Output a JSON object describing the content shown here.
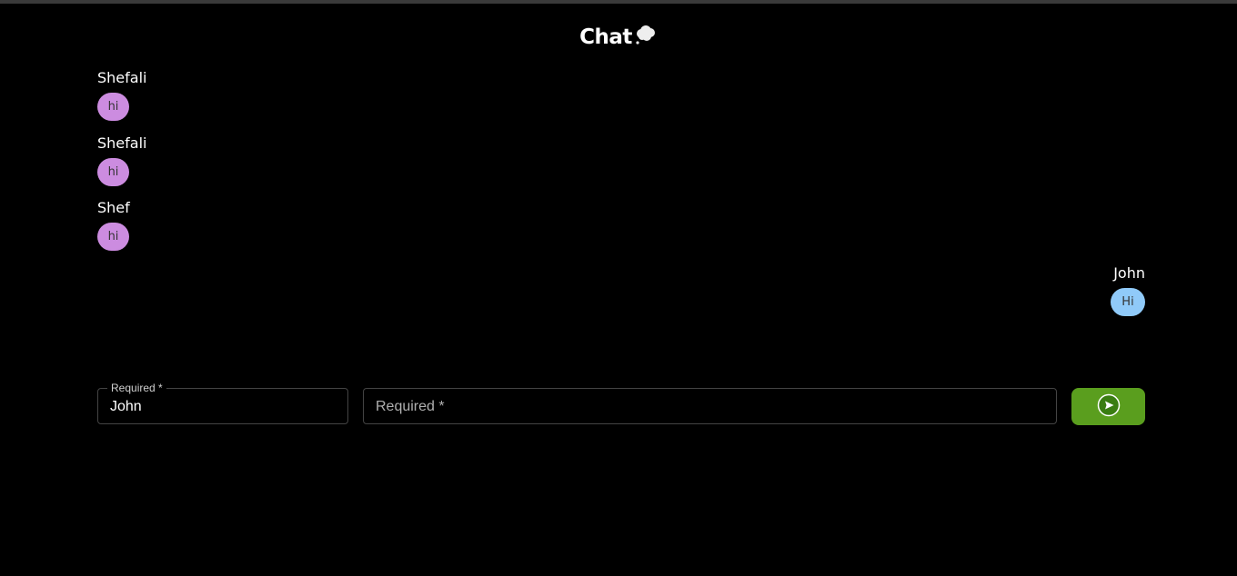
{
  "header": {
    "title": "Chat"
  },
  "messages": [
    {
      "sender": "Shefali",
      "text": "hi",
      "side": "left"
    },
    {
      "sender": "Shefali",
      "text": "hi",
      "side": "left"
    },
    {
      "sender": "Shef",
      "text": "hi",
      "side": "left"
    },
    {
      "sender": "John",
      "text": "Hi",
      "side": "right"
    }
  ],
  "form": {
    "name_legend": "Required *",
    "name_value": "John",
    "message_placeholder": "Required *"
  },
  "colors": {
    "background": "#000000",
    "received_bubble": "#cc8ce0",
    "sent_bubble": "#90caf9",
    "send_button": "#5a9e1e"
  },
  "icons": {
    "title_icon": "thought-bubble-icon",
    "send_icon": "send-arrow-icon"
  }
}
